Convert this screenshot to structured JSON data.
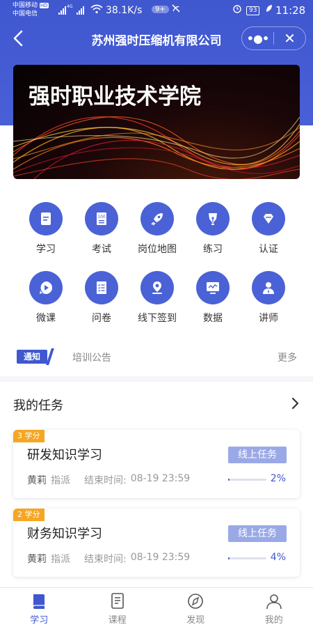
{
  "status_bar": {
    "carrier_1": "中国移动",
    "carrier_1_badge": "HD",
    "carrier_2": "中国电信",
    "network": "4G",
    "speed": "38.1K/s",
    "notif_count": "9+",
    "battery": "93",
    "time": "11:28"
  },
  "header": {
    "title": "苏州强时压缩机有限公司",
    "more_label": "•●•",
    "close_label": "✕"
  },
  "banner": {
    "title": "强时职业技术学院"
  },
  "features": [
    {
      "label": "学习",
      "icon": "document-icon"
    },
    {
      "label": "考试",
      "icon": "exam-icon"
    },
    {
      "label": "岗位地图",
      "icon": "rocket-icon"
    },
    {
      "label": "练习",
      "icon": "pen-nib-icon"
    },
    {
      "label": "认证",
      "icon": "diamond-icon"
    },
    {
      "label": "微课",
      "icon": "play-icon"
    },
    {
      "label": "问卷",
      "icon": "checklist-icon"
    },
    {
      "label": "线下签到",
      "icon": "location-icon"
    },
    {
      "label": "数据",
      "icon": "chart-icon"
    },
    {
      "label": "讲师",
      "icon": "teacher-icon"
    }
  ],
  "notice": {
    "tag": "通知",
    "text": "培训公告",
    "more": "更多"
  },
  "tasks": {
    "heading": "我的任务",
    "items": [
      {
        "credit": "3 学分",
        "title": "研发知识学习",
        "type": "线上任务",
        "assigner": "黄莉",
        "action": "指派",
        "end_label": "结束时间:",
        "end_time": "08-19 23:59",
        "progress_text": "2%",
        "progress": 0.02
      },
      {
        "credit": "2 学分",
        "title": "财务知识学习",
        "type": "线上任务",
        "assigner": "黄莉",
        "action": "指派",
        "end_label": "结束时间:",
        "end_time": "08-19 23:59",
        "progress_text": "4%",
        "progress": 0.04
      }
    ]
  },
  "tabbar": [
    {
      "label": "学习",
      "icon": "book-icon",
      "active": true
    },
    {
      "label": "课程",
      "icon": "course-icon",
      "active": false
    },
    {
      "label": "发现",
      "icon": "compass-icon",
      "active": false
    },
    {
      "label": "我的",
      "icon": "user-icon",
      "active": false
    }
  ],
  "colors": {
    "primary": "#3f57cf",
    "icon_circle": "#4a62d6",
    "credit_badge": "#f5a623",
    "task_tag": "#9aa9e6"
  }
}
